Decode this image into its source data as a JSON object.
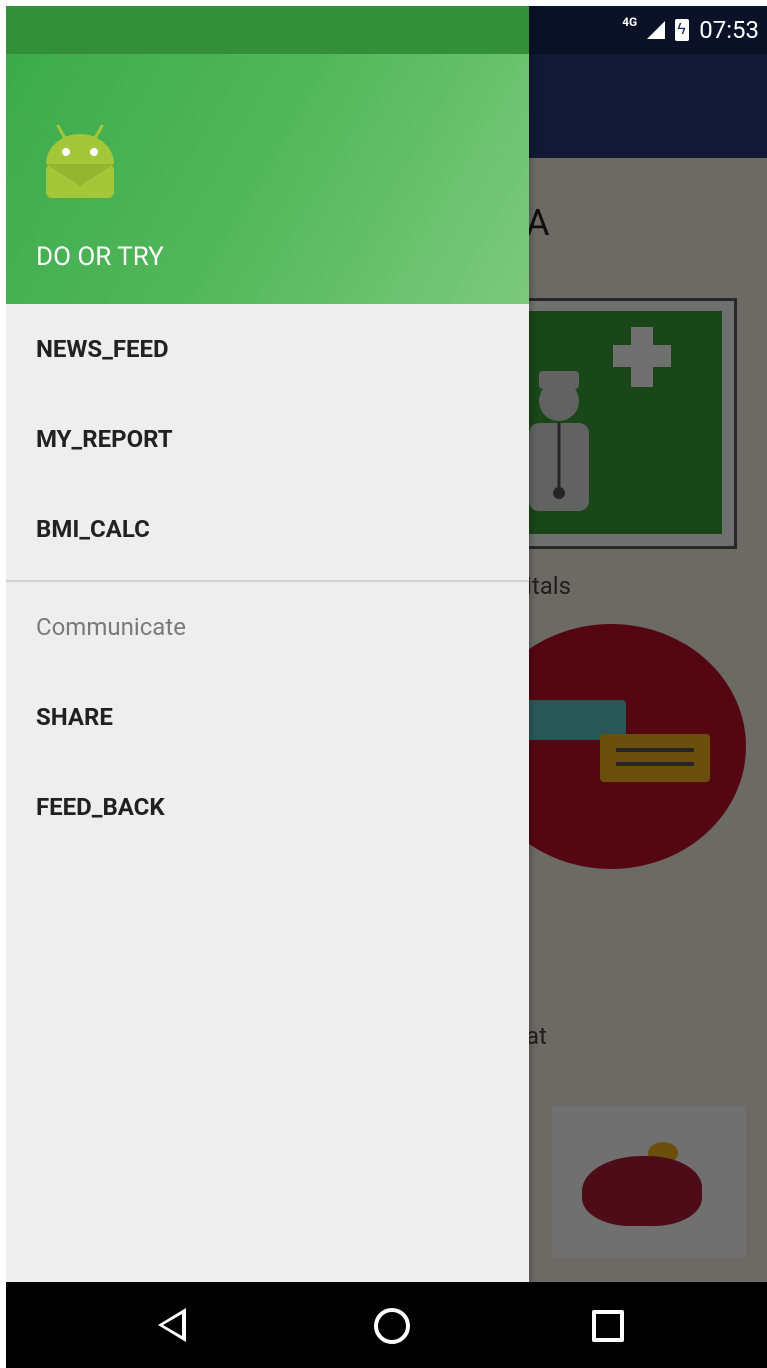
{
  "status_bar": {
    "network": "4G",
    "time": "07:53"
  },
  "background": {
    "title_partial": "A",
    "vitals_label_partial": "itals",
    "chat_label_partial": "at"
  },
  "drawer": {
    "header_title": "DO OR TRY",
    "primary_items": [
      "NEWS_FEED",
      "MY_REPORT",
      "BMI_CALC"
    ],
    "section_title": "Communicate",
    "secondary_items": [
      "SHARE",
      "FEED_BACK"
    ]
  },
  "nav_bar": {
    "buttons": [
      "back",
      "home",
      "recents"
    ]
  },
  "colors": {
    "drawer_header": "#4caf50",
    "app_bar": "#283a78",
    "drawer_bg": "#eeeeee"
  }
}
